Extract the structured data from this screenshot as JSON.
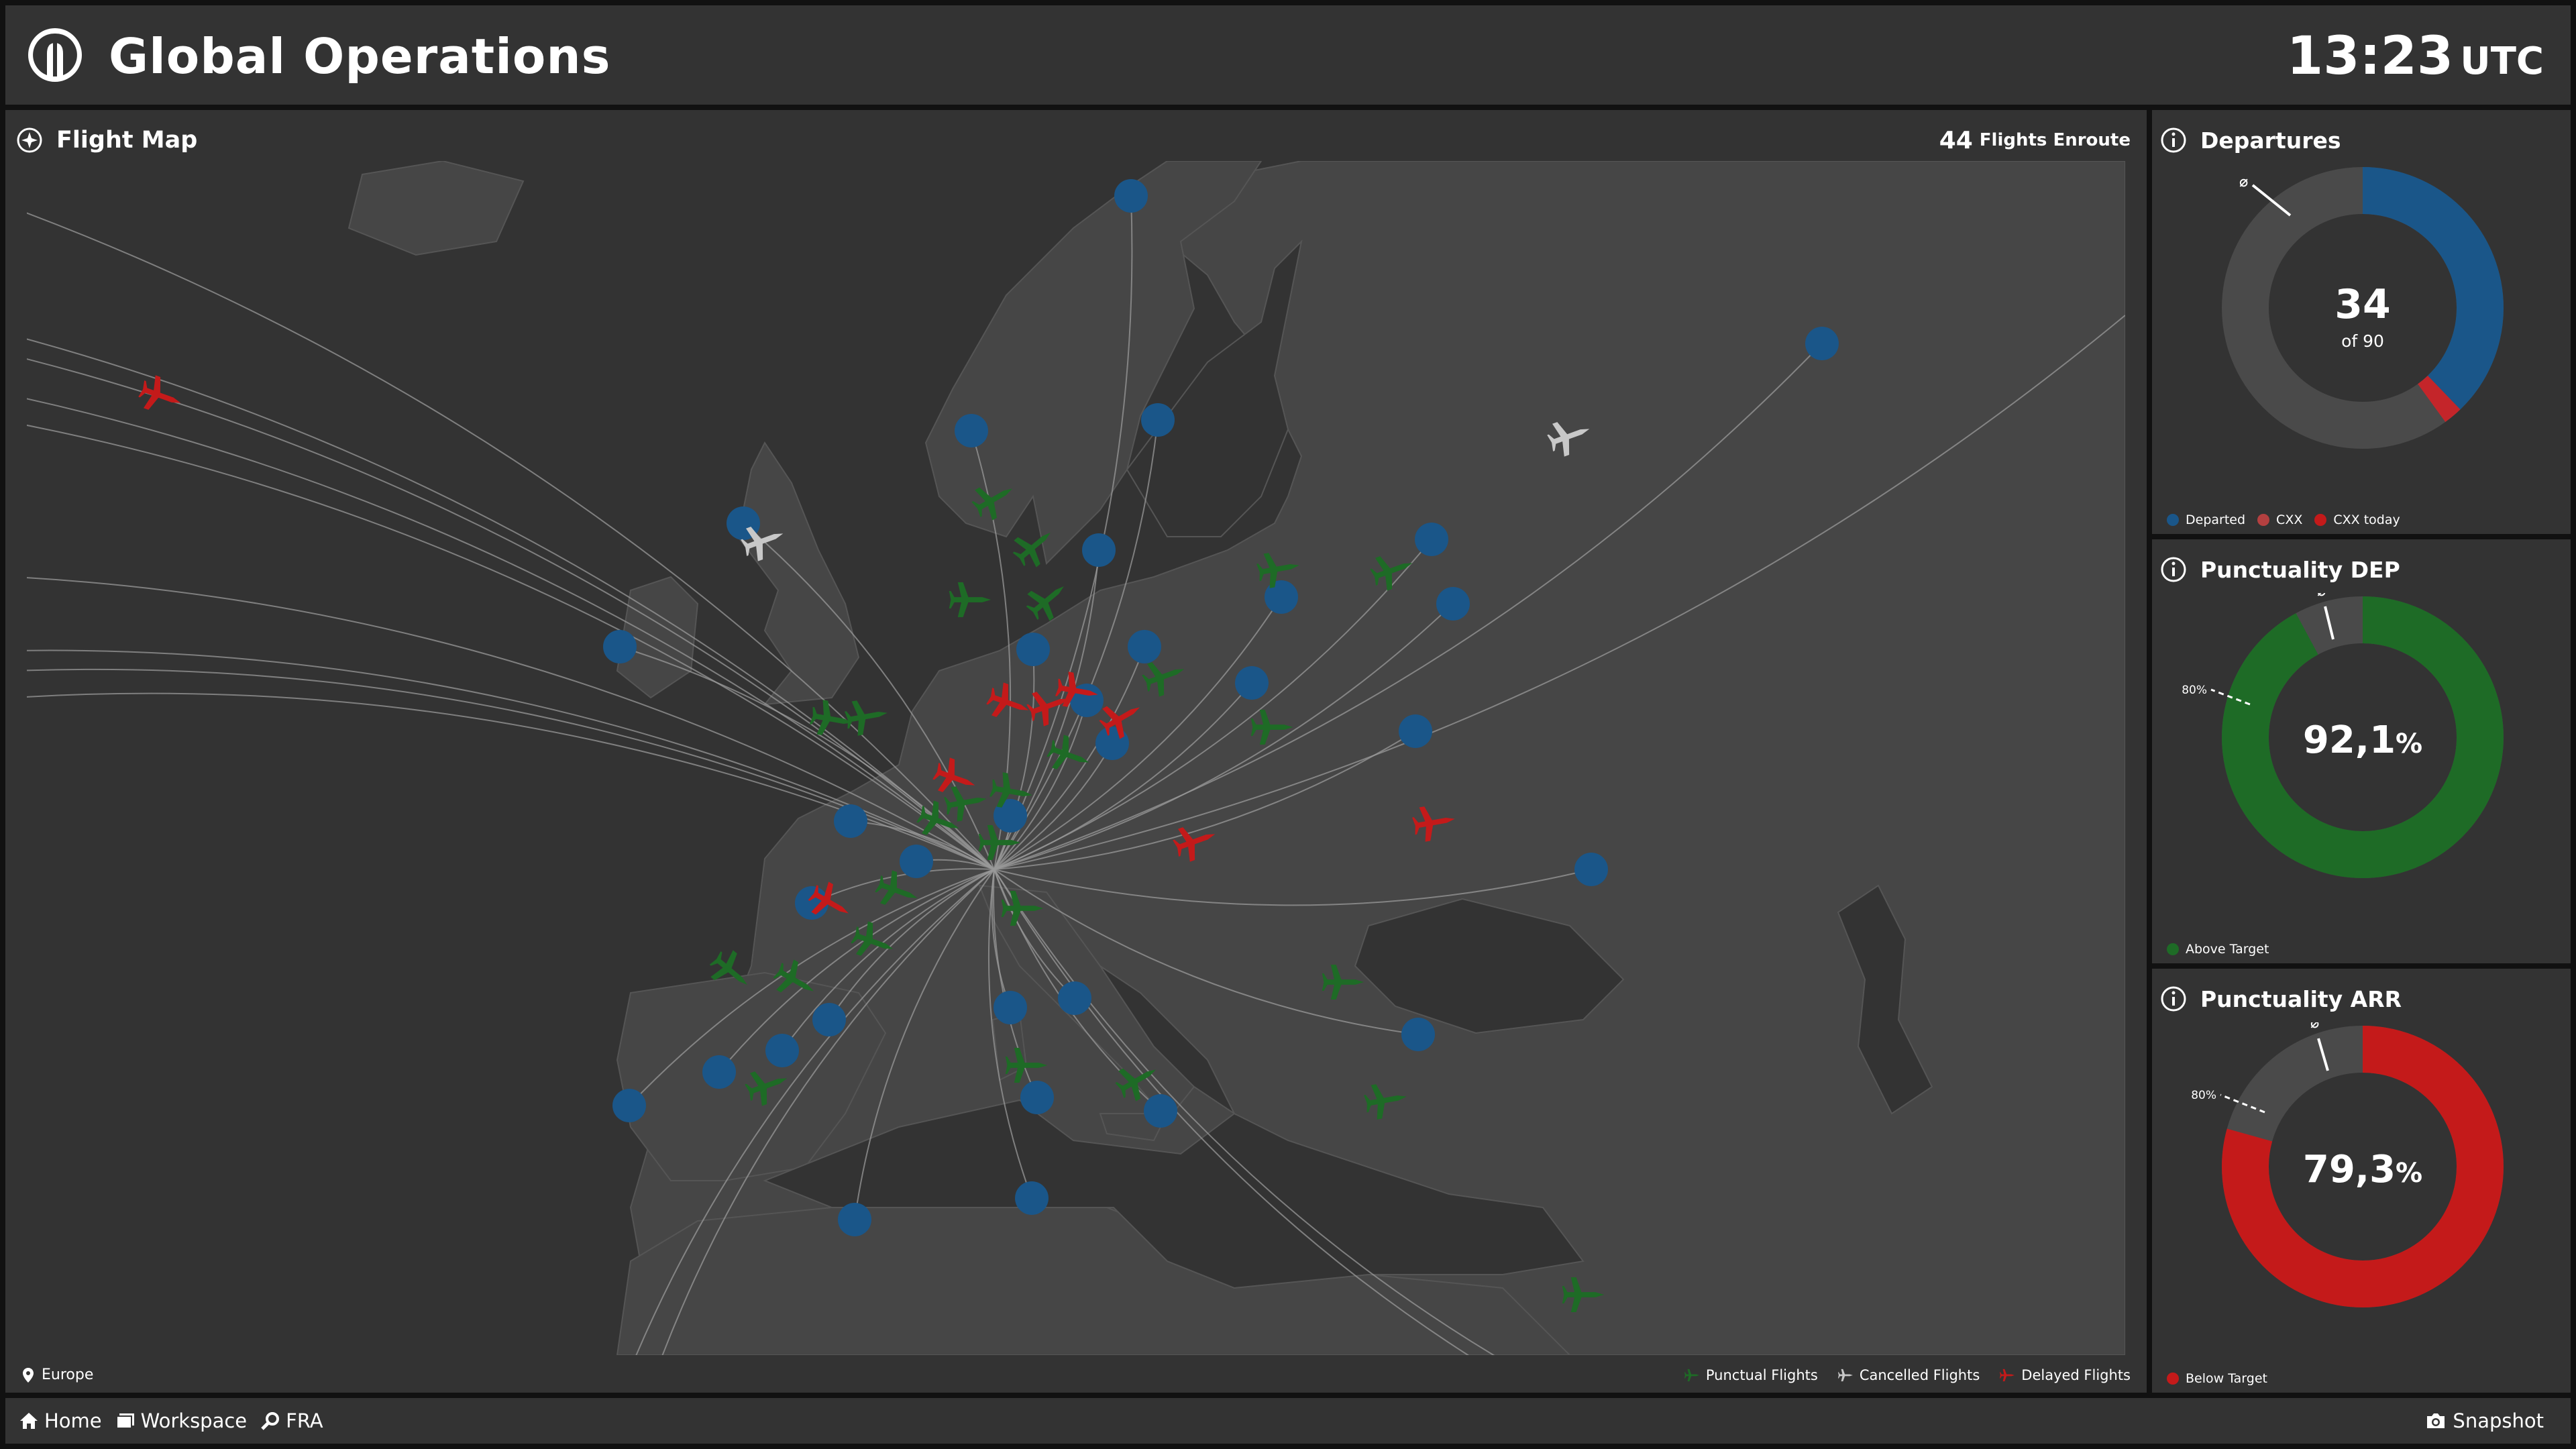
{
  "header": {
    "title": "Global Operations",
    "time": "13:23",
    "timezone": "UTC"
  },
  "map_panel": {
    "title": "Flight Map",
    "enroute_count": "44",
    "enroute_label": "Flights Enroute",
    "region": "Europe",
    "legend": {
      "punctual": "Punctual Flights",
      "cancelled": "Cancelled Flights",
      "delayed": "Delayed Flights"
    }
  },
  "departures": {
    "title": "Departures",
    "value": "34",
    "sub": "of 90",
    "avg_symbol": "⌀",
    "departed_fraction": 0.378,
    "cxx_fraction": 0.022,
    "legend": [
      "Departed",
      "CXX",
      "CXX today"
    ]
  },
  "punctuality_dep": {
    "title": "Punctuality DEP",
    "value": "92,1",
    "unit": "%",
    "target": "80%",
    "avg_symbol": "⌀",
    "fraction": 0.921,
    "legend": "Above Target"
  },
  "punctuality_arr": {
    "title": "Punctuality ARR",
    "value": "79,3",
    "unit": "%",
    "target": "80%",
    "avg_symbol": "⌀",
    "fraction": 0.793,
    "legend": "Below Target"
  },
  "footer": {
    "home": "Home",
    "workspace": "Workspace",
    "airport": "FRA",
    "snapshot": "Snapshot"
  },
  "colors": {
    "departed": "#1a5689",
    "cxx": "#c4252a",
    "punctual": "#1e6b26",
    "delayed": "#c41a1a",
    "cancelled": "#c8c8c8",
    "track": "#4a4a4a",
    "land": "#464646",
    "sea": "#333333"
  }
}
